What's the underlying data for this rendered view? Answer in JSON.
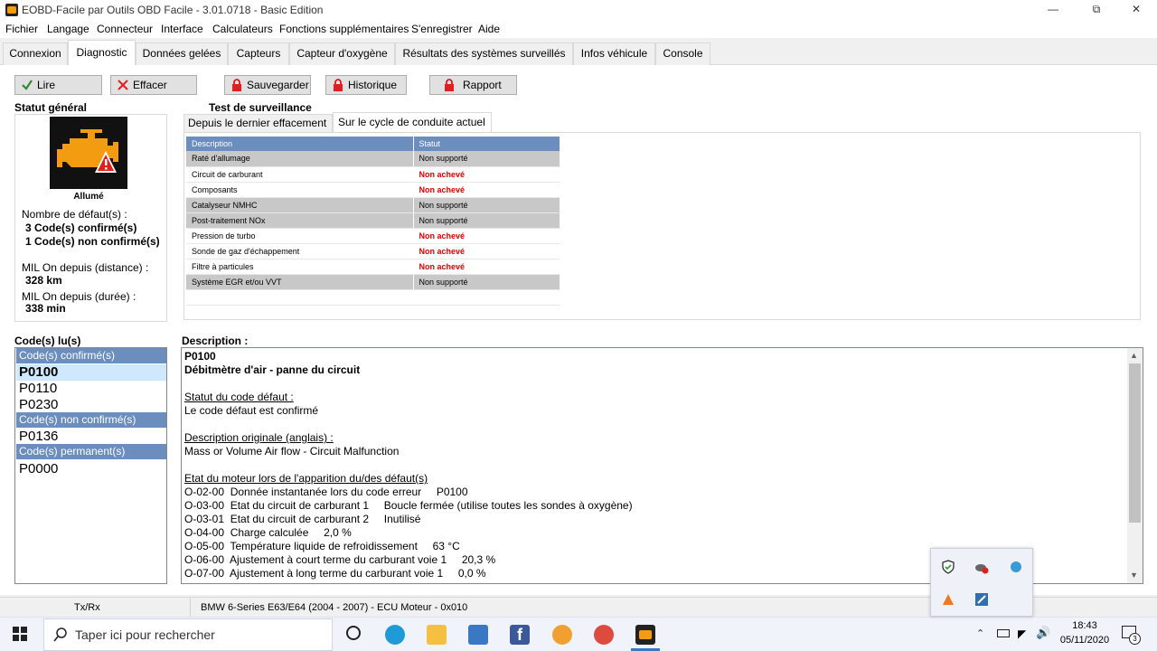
{
  "window": {
    "title": "EOBD-Facile par Outils OBD Facile - 3.01.0718 - Basic Edition"
  },
  "menu": [
    "Fichier",
    "Langage",
    "Connecteur",
    "Interface",
    "Calculateurs",
    "Fonctions supplémentaires",
    "S'enregistrer",
    "Aide"
  ],
  "tabs": [
    "Connexion",
    "Diagnostic",
    "Données gelées",
    "Capteurs",
    "Capteur d'oxygène",
    "Résultats des systèmes surveillés",
    "Infos véhicule",
    "Console"
  ],
  "active_tab": "Diagnostic",
  "toolbar": {
    "read": "Lire",
    "clear": "Effacer",
    "save": "Sauvegarder",
    "history": "Historique",
    "report": "Rapport"
  },
  "status": {
    "title": "Statut général",
    "mil_state": "Allumé",
    "fault_count_label": "Nombre de défaut(s) :",
    "confirmed": "3 Code(s) confirmé(s)",
    "unconfirmed": "1 Code(s) non confirmé(s)",
    "distance_label": "MIL On depuis (distance) :",
    "distance_value": "328 km",
    "duration_label": "MIL On depuis (durée) :",
    "duration_value": "338 min"
  },
  "monitor": {
    "title": "Test de surveillance",
    "subtabs": [
      "Depuis le dernier effacement",
      "Sur le cycle de conduite actuel"
    ],
    "headers": [
      "Description",
      "Statut"
    ],
    "rows": [
      {
        "name": "Raté d'allumage",
        "status": "Non supporté"
      },
      {
        "name": "Circuit de carburant",
        "status": "Non achevé"
      },
      {
        "name": "Composants",
        "status": "Non achevé"
      },
      {
        "name": "Catalyseur NMHC",
        "status": "Non supporté"
      },
      {
        "name": "Post-traitement NOx",
        "status": "Non supporté"
      },
      {
        "name": "Pression de turbo",
        "status": "Non achevé"
      },
      {
        "name": "Sonde de gaz d'échappement",
        "status": "Non achevé"
      },
      {
        "name": "Filtre à particules",
        "status": "Non achevé"
      },
      {
        "name": "Système EGR et/ou VVT",
        "status": "Non supporté"
      }
    ]
  },
  "codes": {
    "title": "Code(s) lu(s)",
    "confirmed_header": "Code(s) confirmé(s)",
    "confirmed": [
      "P0100",
      "P0110",
      "P0230"
    ],
    "unconfirmed_header": "Code(s) non confirmé(s)",
    "unconfirmed": [
      "P0136"
    ],
    "permanent_header": "Code(s) permanent(s)",
    "permanent": [
      "P0000"
    ]
  },
  "description": {
    "title": "Description :",
    "code": "P0100",
    "name": "Débitmètre d'air - panne du circuit",
    "status_label": "Statut du code défaut :",
    "status_text": "Le code défaut est confirmé",
    "orig_label": "Description originale (anglais) :",
    "orig_text": "Mass or Volume Air flow - Circuit Malfunction",
    "freeze_label": "Etat du moteur lors de l'apparition du/des défaut(s)",
    "freeze_lines": [
      "O-02-00  Donnée instantanée lors du code erreur     P0100",
      "O-03-00  Etat du circuit de carburant 1     Boucle fermée (utilise toutes les sondes à oxygène)",
      "O-03-01  Etat du circuit de carburant 2     Inutilisé",
      "O-04-00  Charge calculée     2,0 %",
      "O-05-00  Température liquide de refroidissement     63 °C",
      "O-06-00  Ajustement à court terme du carburant voie 1     20,3 %",
      "O-07-00  Ajustement à long terme du carburant voie 1     0,0 %"
    ]
  },
  "statusbar": {
    "txrx": "Tx/Rx",
    "vehicle": "BMW 6-Series E63/E64 (2004 - 2007) - ECU Moteur - 0x010"
  },
  "taskbar": {
    "search_placeholder": "Taper ici pour rechercher",
    "time": "18:43",
    "date": "05/11/2020",
    "notif_count": "3"
  },
  "colors": {
    "header_blue": "#6c8ebf",
    "bad_red": "#e00000",
    "engine_orange": "#f39c12"
  }
}
